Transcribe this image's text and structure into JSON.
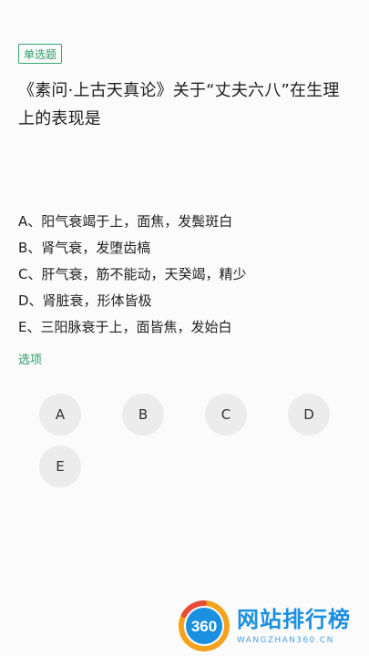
{
  "question": {
    "type_tag": "单选题",
    "text": "《素问·上古天真论》关于“丈夫六八”在生理上的表现是"
  },
  "options": [
    "A、阳气衰竭于上，面焦，发鬓斑白",
    "B、肾气衰，发堕齿槁",
    "C、肝气衰，筋不能动，天癸竭，精少",
    "D、肾脏衰，形体皆极",
    "E、三阳脉衰于上，面皆焦，发始白"
  ],
  "choices_section_label": "选项",
  "choices": [
    "A",
    "B",
    "C",
    "D",
    "E"
  ],
  "watermark": {
    "logo_text": "360",
    "title": "网站排行榜",
    "subtitle": "WANGZHAN360.CN"
  },
  "colors": {
    "accent_green": "#2e9a68",
    "watermark_blue": "#1b8fe0",
    "choice_bg": "#ececec"
  }
}
